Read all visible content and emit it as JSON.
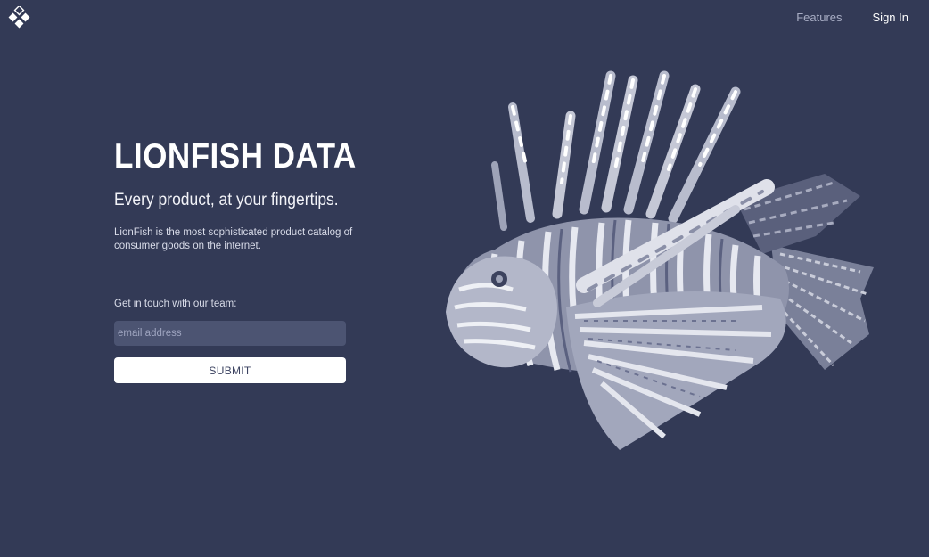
{
  "header": {
    "logo_icon": "diamond-cluster-logo",
    "nav": [
      {
        "label": "Features"
      },
      {
        "label": "Sign In"
      }
    ]
  },
  "hero": {
    "title": "LIONFISH DATA",
    "subtitle": "Every product, at your fingertips.",
    "description": "LionFish is the most sophisticated product catalog of consumer goods on the internet.",
    "contact_label": "Get in touch with our team:",
    "email_placeholder": "email address",
    "submit_label": "SUBMIT",
    "illustration_icon": "lionfish-illustration"
  },
  "colors": {
    "background": "#333a56",
    "input_bg": "#4c5472",
    "button_bg": "#ffffff",
    "nav_muted": "#a8adc4"
  }
}
